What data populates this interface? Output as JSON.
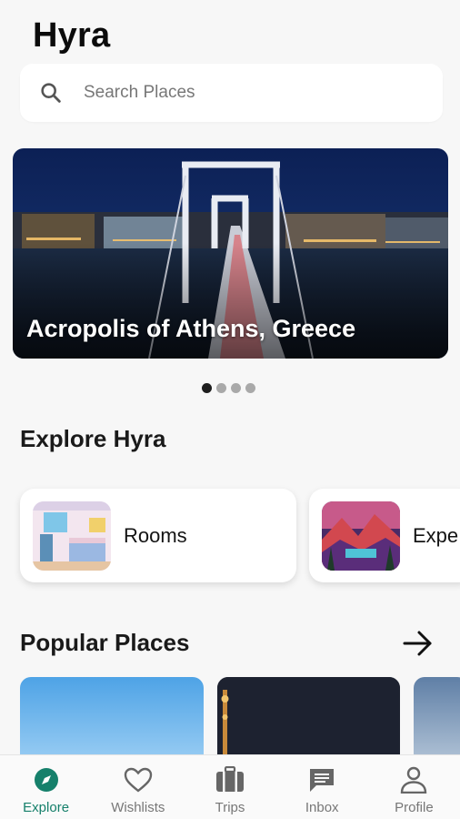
{
  "app": {
    "title": "Hyra"
  },
  "search": {
    "placeholder": "Search Places",
    "icon": "search-icon"
  },
  "hero": {
    "caption": "Acropolis of Athens, Greece",
    "carousel": {
      "total": 4,
      "active": 1
    }
  },
  "explore": {
    "title": "Explore Hyra",
    "categories": [
      {
        "label": "Rooms",
        "icon": "room-illustration"
      },
      {
        "label": "Expe",
        "icon": "landscape-illustration"
      }
    ]
  },
  "popular": {
    "title": "Popular Places",
    "action_icon": "arrow-right-icon"
  },
  "bottom_nav": {
    "items": [
      {
        "label": "Explore",
        "icon": "compass-icon",
        "active": true
      },
      {
        "label": "Wishlists",
        "icon": "heart-icon",
        "active": false
      },
      {
        "label": "Trips",
        "icon": "luggage-icon",
        "active": false
      },
      {
        "label": "Inbox",
        "icon": "message-icon",
        "active": false
      },
      {
        "label": "Profile",
        "icon": "person-icon",
        "active": false
      }
    ]
  },
  "colors": {
    "accent": "#16806b",
    "background": "#f7f7f7",
    "dark_text": "#111111"
  }
}
